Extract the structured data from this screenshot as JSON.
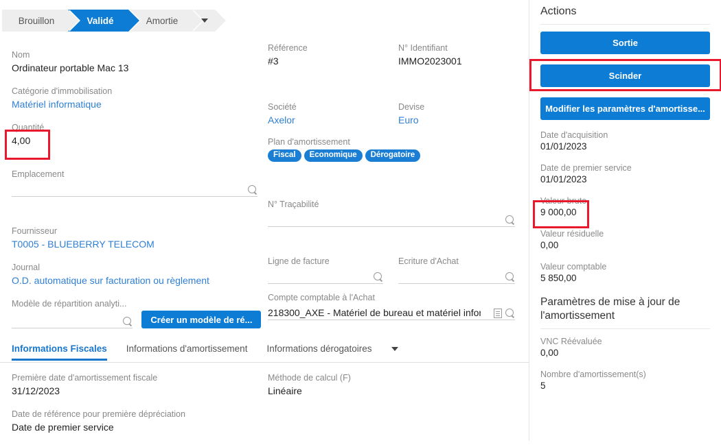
{
  "pipeline": {
    "states": [
      {
        "label": "Brouillon",
        "active": false
      },
      {
        "label": "Validé",
        "active": true
      },
      {
        "label": "Amortie",
        "active": false
      }
    ],
    "more_icon": "chevron-down-icon"
  },
  "left": {
    "nom": {
      "label": "Nom",
      "value": "Ordinateur portable Mac 13"
    },
    "categorie": {
      "label": "Catégorie d'immobilisation",
      "value": "Matériel informatique"
    },
    "quantite": {
      "label": "Quantité",
      "value": "4,00",
      "highlight_color": "#e8192c"
    },
    "emplacement": {
      "label": "Emplacement",
      "value": "",
      "icon": "search-icon"
    },
    "fournisseur": {
      "label": "Fournisseur",
      "value": "T0005 - BLUEBERRY TELECOM"
    },
    "journal": {
      "label": "Journal",
      "value": "O.D. automatique sur facturation ou règlement"
    },
    "modele": {
      "label": "Modèle de répartition analyti...",
      "value": "",
      "icon": "search-icon"
    },
    "creer_modele_button": "Créer un modèle de ré..."
  },
  "mid": {
    "reference": {
      "label": "Référence",
      "value": "#3"
    },
    "identifiant": {
      "label": "N° Identifiant",
      "value": "IMMO2023001"
    },
    "societe": {
      "label": "Société",
      "value": "Axelor"
    },
    "devise": {
      "label": "Devise",
      "value": "Euro"
    },
    "plan": {
      "label": "Plan d'amortissement",
      "badges": [
        "Fiscal",
        "Economique",
        "Dérogatoire"
      ]
    },
    "tracabilite": {
      "label": "N° Traçabilité",
      "value": "",
      "icon": "search-icon"
    },
    "ligne_facture": {
      "label": "Ligne de facture",
      "value": "",
      "icon": "search-icon"
    },
    "ecriture_achat": {
      "label": "Ecriture d'Achat",
      "value": "",
      "icon": "search-icon"
    },
    "compte_comptable": {
      "label": "Compte comptable à l'Achat",
      "value": "218300_AXE - Matériel de bureau et matériel inform",
      "icons": [
        "document-icon",
        "search-icon"
      ]
    }
  },
  "tabs": {
    "items": [
      {
        "label": "Informations Fiscales",
        "active": true
      },
      {
        "label": "Informations d'amortissement",
        "active": false
      },
      {
        "label": "Informations dérogatoires",
        "active": false
      }
    ],
    "more_icon": "chevron-down-icon",
    "content": {
      "premiere_date": {
        "label": "Première date d'amortissement fiscale",
        "value": "31/12/2023"
      },
      "methode": {
        "label": "Méthode de calcul (F)",
        "value": "Linéaire"
      },
      "date_reference": {
        "label": "Date de référence pour première dépréciation",
        "value": "Date de premier service"
      }
    }
  },
  "sidebar": {
    "title": "Actions",
    "buttons": [
      {
        "label": "Sortie",
        "highlighted": false
      },
      {
        "label": "Scinder",
        "highlighted": true
      },
      {
        "label": "Modifier les paramètres d'amortisse...",
        "highlighted": false
      }
    ],
    "accent_color": "#0c7cd5",
    "highlight_color": "#e8192c",
    "fields": [
      {
        "label": "Date d'acquisition",
        "value": "01/01/2023"
      },
      {
        "label": "Date de premier service",
        "value": "01/01/2023"
      },
      {
        "label": "Valeur brute",
        "value": "9 000,00"
      },
      {
        "label": "Valeur résiduelle",
        "value": "0,00"
      },
      {
        "label": "Valeur comptable",
        "value": "5 850,00"
      }
    ],
    "section2_title": "Paramètres de mise à jour de l'amortissement",
    "fields2": [
      {
        "label": "VNC Réévaluée",
        "value": "0,00"
      },
      {
        "label": "Nombre d'amortissement(s)",
        "value": "5"
      }
    ]
  }
}
